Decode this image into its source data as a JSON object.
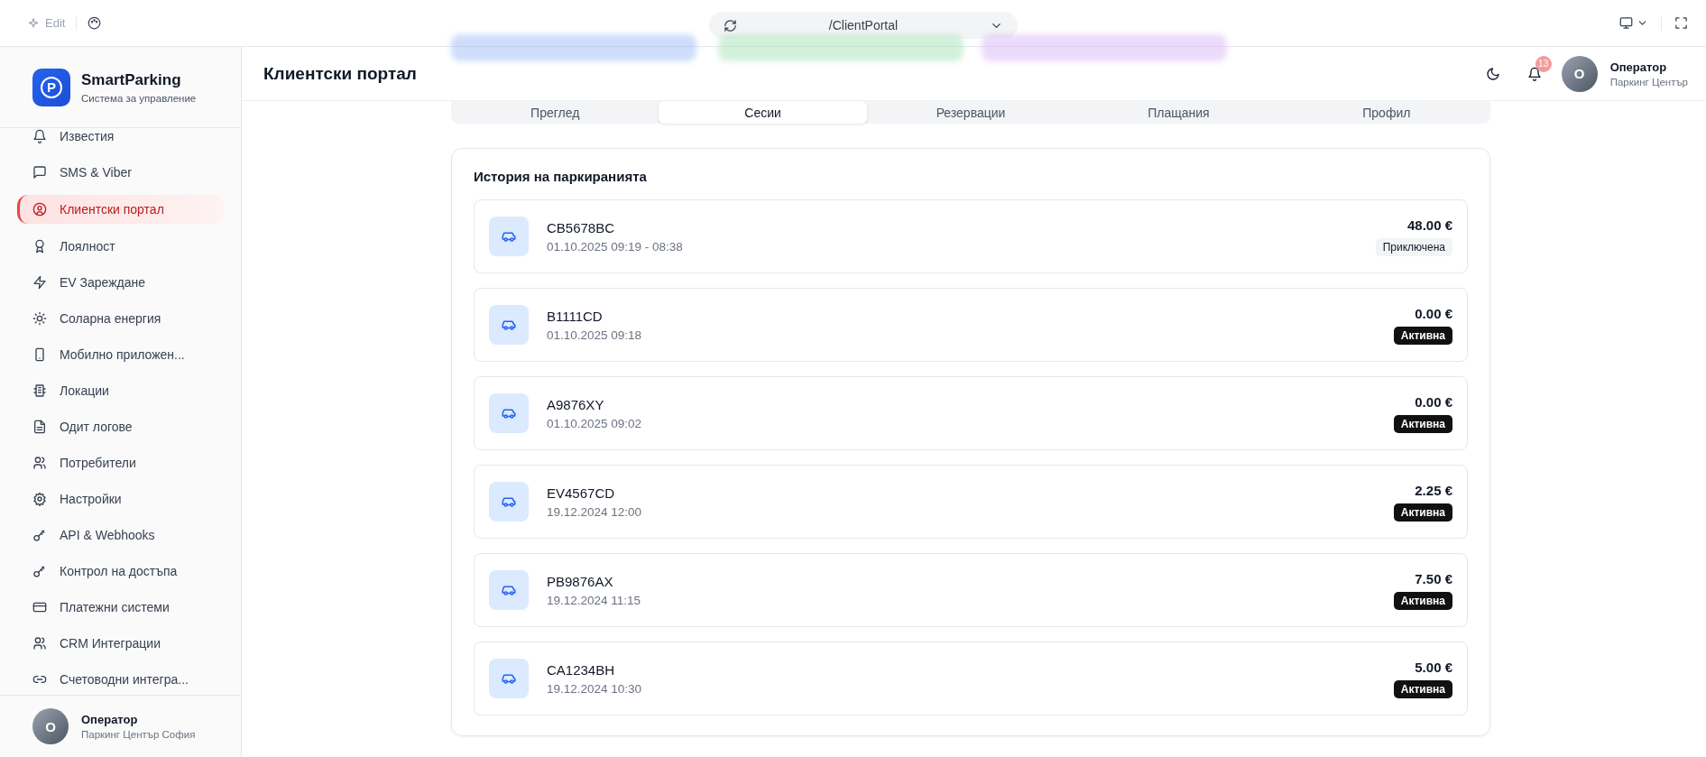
{
  "topbar": {
    "edit_label": "Edit",
    "url": "/ClientPortal"
  },
  "brand": {
    "name": "SmartParking",
    "subtitle": "Система за управление",
    "logo_letter": "P"
  },
  "sidebar": {
    "items": [
      {
        "label": "Известия",
        "selected": false
      },
      {
        "label": "SMS & Viber",
        "selected": false
      },
      {
        "label": "Клиентски портал",
        "selected": true
      },
      {
        "label": "Лоялност",
        "selected": false
      },
      {
        "label": "EV Зареждане",
        "selected": false
      },
      {
        "label": "Соларна енергия",
        "selected": false
      },
      {
        "label": "Мобилно приложен...",
        "selected": false
      },
      {
        "label": "Локации",
        "selected": false
      },
      {
        "label": "Одит логове",
        "selected": false
      },
      {
        "label": "Потребители",
        "selected": false
      },
      {
        "label": "Настройки",
        "selected": false
      },
      {
        "label": "API & Webhooks",
        "selected": false
      },
      {
        "label": "Контрол на достъпа",
        "selected": false
      },
      {
        "label": "Платежни системи",
        "selected": false
      },
      {
        "label": "CRM Интеграции",
        "selected": false
      },
      {
        "label": "Счетоводни интегра...",
        "selected": false
      }
    ],
    "user": {
      "initial": "O",
      "name": "Оператор",
      "location": "Паркинг Център София"
    }
  },
  "header": {
    "title": "Клиентски портал",
    "notification_count": "13",
    "user": {
      "initial": "O",
      "name": "Оператор",
      "location": "Паркинг Център"
    }
  },
  "tabs": [
    {
      "label": "Преглед",
      "selected": false
    },
    {
      "label": "Сесии",
      "selected": true
    },
    {
      "label": "Резервации",
      "selected": false
    },
    {
      "label": "Плащания",
      "selected": false
    },
    {
      "label": "Профил",
      "selected": false
    }
  ],
  "sessions": {
    "title": "История на паркиранията",
    "rows": [
      {
        "plate": "CB5678BC",
        "time": "01.10.2025 09:19 - 08:38",
        "amount": "48.00 €",
        "status": {
          "label": "Приключена",
          "kind": "ended"
        }
      },
      {
        "plate": "B1111CD",
        "time": "01.10.2025 09:18",
        "amount": "0.00 €",
        "status": {
          "label": "Активна",
          "kind": "active"
        }
      },
      {
        "plate": "A9876XY",
        "time": "01.10.2025 09:02",
        "amount": "0.00 €",
        "status": {
          "label": "Активна",
          "kind": "active"
        }
      },
      {
        "plate": "EV4567CD",
        "time": "19.12.2024 12:00",
        "amount": "2.25 €",
        "status": {
          "label": "Активна",
          "kind": "active"
        }
      },
      {
        "plate": "PB9876AX",
        "time": "19.12.2024 11:15",
        "amount": "7.50 €",
        "status": {
          "label": "Активна",
          "kind": "active"
        }
      },
      {
        "plate": "CA1234BH",
        "time": "19.12.2024 10:30",
        "amount": "5.00 €",
        "status": {
          "label": "Активна",
          "kind": "active"
        }
      }
    ]
  }
}
